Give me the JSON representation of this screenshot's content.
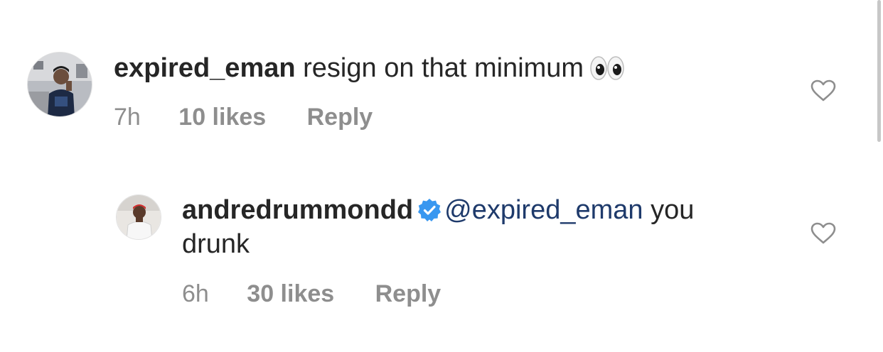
{
  "comments": [
    {
      "username": "expired_eman",
      "text": "resign on that minimum",
      "emoji": "eyes-emoji",
      "time": "7h",
      "likes": "10 likes",
      "reply": "Reply",
      "verified": false
    },
    {
      "username": "andredrummondd",
      "verified": true,
      "mention": "@expired_eman",
      "text_line1": "you",
      "text_line2": "drunk",
      "time": "6h",
      "likes": "30 likes",
      "reply": "Reply"
    }
  ],
  "icons": {
    "like": "heart-outline-icon",
    "verified": "verified-badge-icon"
  },
  "colors": {
    "text": "#262626",
    "meta": "#8e8e8e",
    "mention": "#1e3a6b",
    "verified": "#3897f0",
    "scrollbar": "#c7c7c7"
  }
}
